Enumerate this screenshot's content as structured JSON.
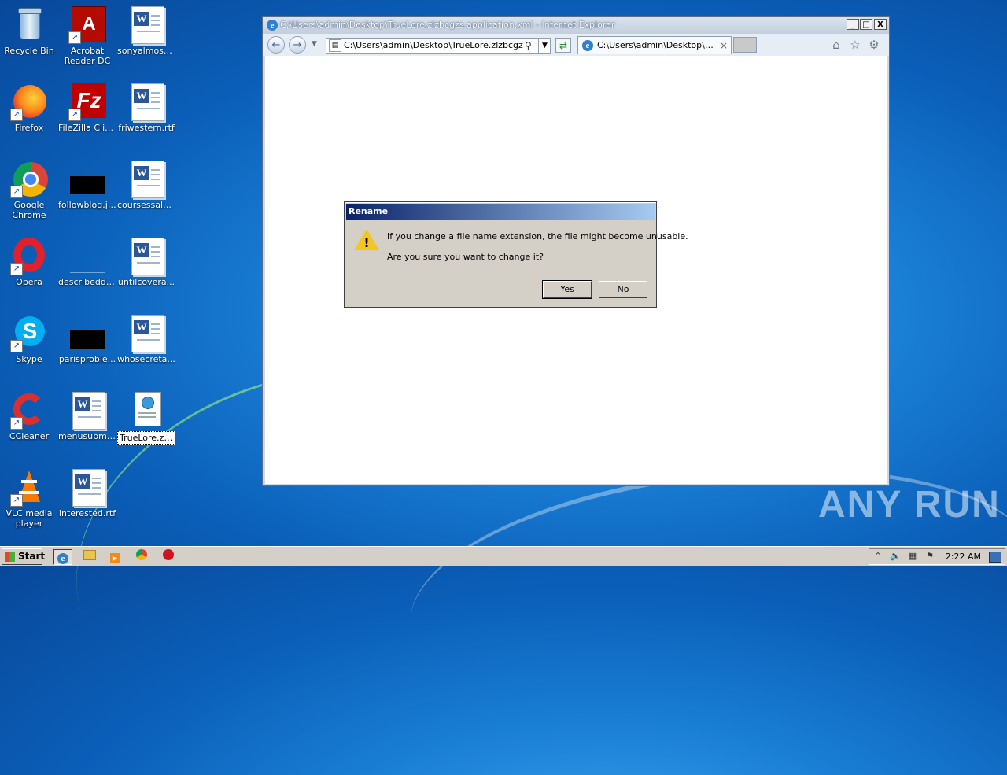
{
  "desktop": {
    "icons": [
      {
        "label": "Recycle Bin",
        "icon": "recycle-bin-icon"
      },
      {
        "label": "Acrobat Reader DC",
        "icon": "acrobat-icon"
      },
      {
        "label": "sonyalmost.rtf",
        "icon": "word-doc-icon"
      },
      {
        "label": "Firefox",
        "icon": "firefox-icon"
      },
      {
        "label": "FileZilla Client",
        "icon": "filezilla-icon"
      },
      {
        "label": "friwestern.rtf",
        "icon": "word-doc-icon"
      },
      {
        "label": "Google Chrome",
        "icon": "chrome-icon"
      },
      {
        "label": "followblog.jpg",
        "icon": "image-file-icon"
      },
      {
        "label": "coursessale...",
        "icon": "word-doc-icon"
      },
      {
        "label": "Opera",
        "icon": "opera-icon"
      },
      {
        "label": "describedde...",
        "icon": "file-icon"
      },
      {
        "label": "untilcovera...",
        "icon": "word-doc-icon"
      },
      {
        "label": "Skype",
        "icon": "skype-icon"
      },
      {
        "label": "parisproble...",
        "icon": "image-file-icon"
      },
      {
        "label": "whosecreta...",
        "icon": "word-doc-icon"
      },
      {
        "label": "CCleaner",
        "icon": "ccleaner-icon"
      },
      {
        "label": "menusubmi...",
        "icon": "word-doc-icon"
      },
      {
        "label": "TrueLore.zlzbcgzs.application",
        "icon": "application-file-icon"
      },
      {
        "label": "VLC media player",
        "icon": "vlc-icon"
      },
      {
        "label": "interested.rtf",
        "icon": "word-doc-icon"
      }
    ]
  },
  "browser": {
    "title": "C:\\Users\\admin\\Desktop\\TrueLore.zlzbcgzs.application.xml - Internet Explorer",
    "address": "C:\\Users\\admin\\Desktop\\TrueLore.zlzbcgzs.application.xml",
    "tab_label": "C:\\Users\\admin\\Desktop\\Tru...",
    "controls": {
      "minimize": "_",
      "maximize": "□",
      "close": "X"
    }
  },
  "dialog": {
    "title": "Rename",
    "message_line1": "If you change a file name extension, the file might become unusable.",
    "message_line2": "Are you sure you want to change it?",
    "yes_label": "Yes",
    "no_label": "No"
  },
  "taskbar": {
    "start_label": "Start",
    "clock": "2:22 AM",
    "pinned": [
      "internet-explorer-icon",
      "explorer-folder-icon",
      "media-player-icon",
      "chrome-icon",
      "opera-icon"
    ]
  },
  "watermark": "ANY RUN",
  "colors": {
    "dialog_title_start": "#0a246a",
    "dialog_title_end": "#a6caf0",
    "warning": "#f3c623"
  }
}
